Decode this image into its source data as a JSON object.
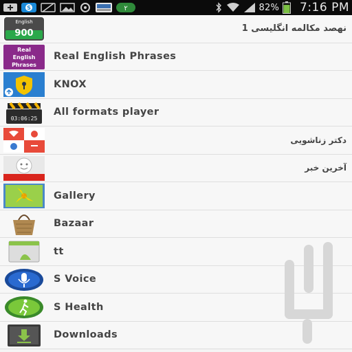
{
  "status_bar": {
    "icons": [
      "add-icon",
      "skype-icon",
      "no-sync-icon",
      "image-icon",
      "settings-icon",
      "app-badge-icon",
      "notification-2-icon",
      "bluetooth-icon",
      "wifi-icon",
      "signal-icon",
      "battery-icon"
    ],
    "notification_badge": "۲",
    "battery_percent": "82%",
    "time": "7:16 PM",
    "colors": {
      "background": "#0b0b0b",
      "text": "#e8e8e8",
      "battery": "#7bc043"
    }
  },
  "apps": [
    {
      "label": "نهصد مکالمه انگلیسی 1",
      "icon": "english-900-icon",
      "icon_text": "English",
      "icon_number": "900",
      "rtl": true
    },
    {
      "label": "Real English Phrases",
      "icon": "real-english-phrases-icon",
      "icon_lines": [
        "Real",
        "English",
        "Phrases"
      ]
    },
    {
      "label": "KNOX",
      "icon": "knox-icon"
    },
    {
      "label": "All formats player",
      "icon": "clapperboard-icon",
      "icon_text": "03:06:25"
    },
    {
      "label": "دکتر زناشویی",
      "icon": "marriage-doctor-icon",
      "rtl": true
    },
    {
      "label": "آخرین خبر",
      "icon": "latest-news-icon",
      "rtl": true
    },
    {
      "label": "Gallery",
      "icon": "gallery-icon"
    },
    {
      "label": "Bazaar",
      "icon": "bazaar-icon"
    },
    {
      "label": "tt",
      "icon": "android-app-icon"
    },
    {
      "label": "S Voice",
      "icon": "s-voice-icon"
    },
    {
      "label": "S Health",
      "icon": "s-health-icon"
    },
    {
      "label": "Downloads",
      "icon": "downloads-icon"
    }
  ],
  "colors": {
    "list_bg": "#f7f7f7",
    "divider": "#dedede",
    "label": "#444444",
    "watermark": "#d7d7d7"
  }
}
